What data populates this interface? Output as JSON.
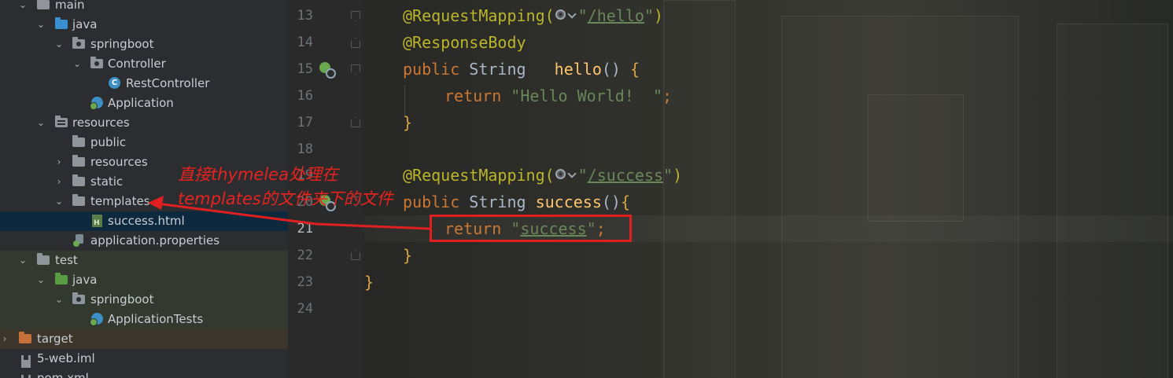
{
  "tree": {
    "items": [
      {
        "label": "main",
        "icon": "folder-icon",
        "expanded": true
      },
      {
        "label": "java",
        "icon": "source-folder-icon",
        "expanded": true
      },
      {
        "label": "springboot",
        "icon": "package-icon",
        "expanded": true
      },
      {
        "label": "Controller",
        "icon": "package-icon",
        "expanded": true
      },
      {
        "label": "RestController",
        "icon": "class-icon"
      },
      {
        "label": "Application",
        "icon": "spring-boot-class-icon"
      },
      {
        "label": "resources",
        "icon": "resources-folder-icon",
        "expanded": true
      },
      {
        "label": "public",
        "icon": "folder-icon"
      },
      {
        "label": "resources",
        "icon": "folder-icon",
        "expanded": false
      },
      {
        "label": "static",
        "icon": "folder-icon",
        "expanded": false
      },
      {
        "label": "templates",
        "icon": "folder-icon",
        "expanded": true
      },
      {
        "label": "success.html",
        "icon": "html-file-icon",
        "selected": true
      },
      {
        "label": "application.properties",
        "icon": "properties-file-icon"
      },
      {
        "label": "test",
        "icon": "folder-icon",
        "expanded": true
      },
      {
        "label": "java",
        "icon": "test-source-folder-icon",
        "expanded": true
      },
      {
        "label": "springboot",
        "icon": "package-icon",
        "expanded": true
      },
      {
        "label": "ApplicationTests",
        "icon": "spring-boot-class-icon"
      },
      {
        "label": "target",
        "icon": "excluded-folder-icon",
        "expanded": false
      },
      {
        "label": "5-web.iml",
        "icon": "module-file-icon"
      },
      {
        "label": "pom.xml",
        "icon": "maven-file-icon"
      }
    ]
  },
  "gutter": {
    "lines": [
      "13",
      "14",
      "15",
      "16",
      "17",
      "18",
      "19",
      "20",
      "21",
      "22",
      "23",
      "24"
    ],
    "current_line": "21"
  },
  "code": {
    "l13": {
      "annotation": "@RequestMapping(",
      "q1": "\"",
      "path": "/hello",
      "q2": "\"",
      "close": ")"
    },
    "l14": {
      "annotation": "@ResponseBody"
    },
    "l15": {
      "kw": "public",
      "type": " String   ",
      "fn": "hello",
      "paren": "() ",
      "brace": "{"
    },
    "l16": {
      "kw": "return",
      "str": " \"Hello World!  \"",
      "semi": ";"
    },
    "l17": {
      "brace": "}"
    },
    "l19": {
      "annotation": "@RequestMapping(",
      "q1": "\"",
      "path": "/success",
      "q2": "\"",
      "close": ")"
    },
    "l20": {
      "kw": "public",
      "type": " String ",
      "fn": "success",
      "paren": "()",
      "brace": "{"
    },
    "l21": {
      "kw": "return",
      "q1": " \"",
      "str": "success",
      "q2": "\"",
      "semi": ";"
    },
    "l22": {
      "brace": "}"
    },
    "l23": {
      "brace": "}"
    }
  },
  "annotation": {
    "line1": "直接thymelea处理在",
    "line2": "templates的文件夹下的文件",
    "color": "#e8231f"
  },
  "colors": {
    "keyword": "#cc7832",
    "annotation": "#bbb529",
    "string": "#6a8759",
    "function": "#ffc66d",
    "text": "#a9b7c6",
    "selection": "#0d293e"
  }
}
